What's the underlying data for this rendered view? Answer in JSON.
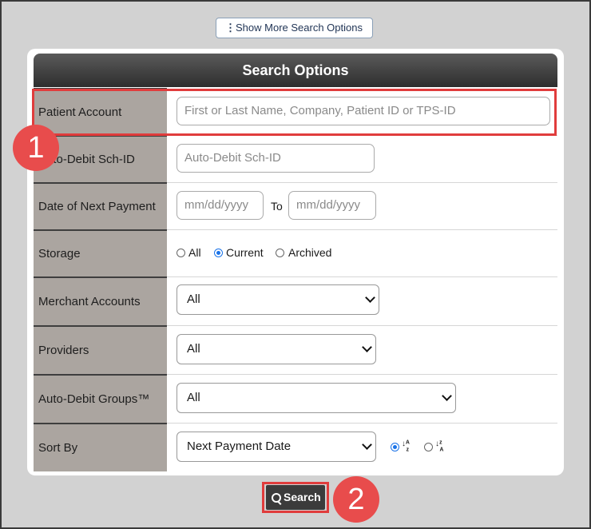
{
  "toolbar": {
    "more_label": "Show More Search Options"
  },
  "panel": {
    "title": "Search Options"
  },
  "fields": {
    "patient_account": {
      "label": "Patient Account",
      "placeholder": "First or Last Name, Company, Patient ID or TPS-ID"
    },
    "auto_debit_sch_id": {
      "label": "Auto-Debit Sch-ID",
      "placeholder": "Auto-Debit Sch-ID"
    },
    "next_payment": {
      "label": "Date of Next Payment",
      "from_placeholder": "mm/dd/yyyy",
      "to_label": "To",
      "to_placeholder": "mm/dd/yyyy"
    },
    "storage": {
      "label": "Storage",
      "options": [
        "All",
        "Current",
        "Archived"
      ],
      "selected": "Current"
    },
    "merchant_accounts": {
      "label": "Merchant Accounts",
      "value": "All"
    },
    "providers": {
      "label": "Providers",
      "value": "All"
    },
    "auto_debit_groups": {
      "label": "Auto-Debit Groups™",
      "value": "All"
    },
    "sort_by": {
      "label": "Sort By",
      "value": "Next Payment Date",
      "order_selected": "ascending"
    }
  },
  "actions": {
    "search_label": "Search"
  },
  "callouts": {
    "one": "1",
    "two": "2"
  },
  "colors": {
    "callout": "#e84c4c",
    "header_dark": "#2e2e2e",
    "label_bg": "#aba5a0",
    "radio_accent": "#1a73e8"
  },
  "icons": {
    "more": "vertical-dots-icon",
    "search": "magnifier-icon",
    "sort_asc": "sort-a-z-icon",
    "sort_desc": "sort-z-a-icon"
  }
}
